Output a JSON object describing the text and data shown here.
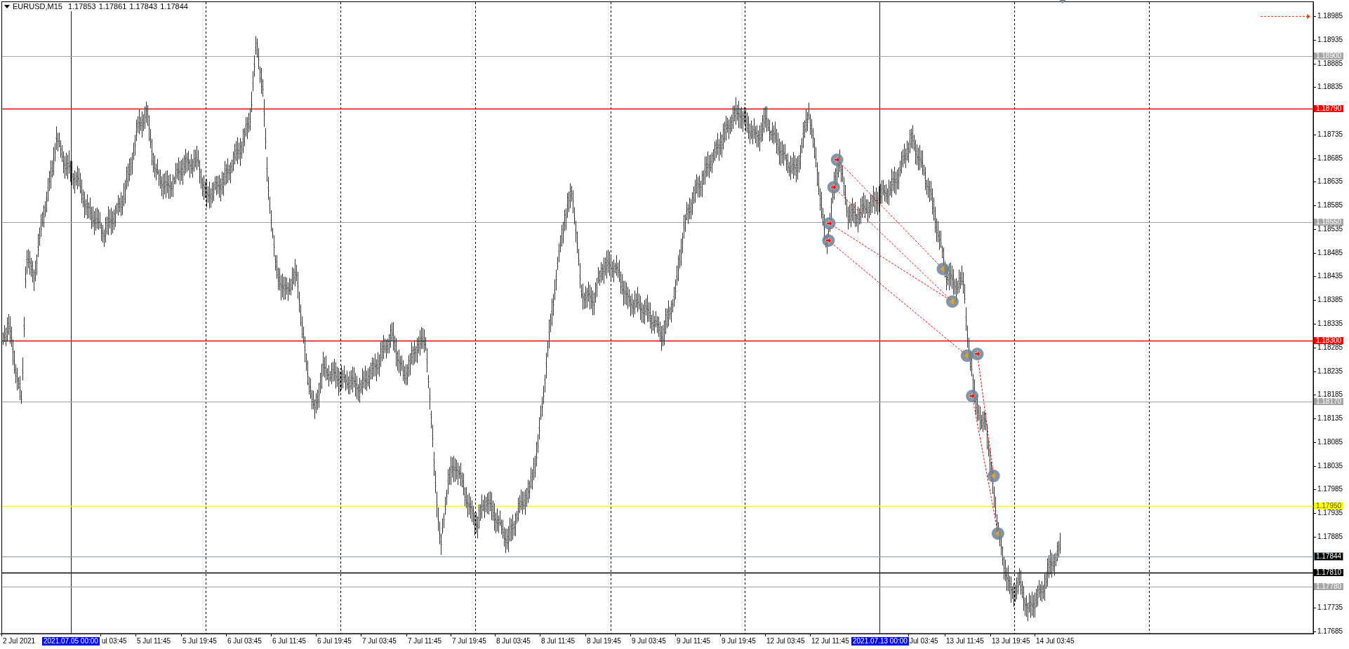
{
  "symbol_info": {
    "symbol": "EURUSD,M15",
    "ohlc": [
      "1.17853",
      "1.17861",
      "1.17843",
      "1.17844"
    ]
  },
  "price_axis": {
    "ticks": [
      "1.18985",
      "1.18935",
      "1.18885",
      "1.18835",
      "1.18735",
      "1.18685",
      "1.18635",
      "1.18585",
      "1.18535",
      "1.18485",
      "1.18435",
      "1.18385",
      "1.18335",
      "1.18285",
      "1.18235",
      "1.18185",
      "1.18135",
      "1.18085",
      "1.18035",
      "1.17985",
      "1.17935",
      "1.17885",
      "1.17735",
      "1.17685"
    ]
  },
  "price_levels": [
    {
      "price": "1.18900",
      "kind": "level",
      "color": "#a6a6a6"
    },
    {
      "price": "1.18790",
      "kind": "level",
      "color": "#ff0000"
    },
    {
      "price": "1.18550",
      "kind": "level",
      "color": "#a6a6a6"
    },
    {
      "price": "1.18300",
      "kind": "level",
      "color": "#ff0000"
    },
    {
      "price": "1.18170",
      "kind": "level",
      "color": "#a6a6a6"
    },
    {
      "price": "1.17950",
      "kind": "level",
      "color": "#ffff00"
    },
    {
      "price": "1.17844",
      "kind": "bid",
      "color": "#8c9aa8"
    },
    {
      "price": "1.17810",
      "kind": "level",
      "color": "#000000"
    },
    {
      "price": "1.17780",
      "kind": "level",
      "color": "#a6a6a6"
    }
  ],
  "time_axis": {
    "labels": [
      {
        "text": "2 Jul 2021",
        "kind": "date"
      },
      {
        "text": "2021.07.05 00:00",
        "kind": "marker"
      },
      {
        "text": "ul 03:45",
        "kind": "date"
      },
      {
        "text": "5 Jul 11:45",
        "kind": "date"
      },
      {
        "text": "5 Jul 19:45",
        "kind": "date"
      },
      {
        "text": "6 Jul 03:45",
        "kind": "date"
      },
      {
        "text": "6 Jul 11:45",
        "kind": "date"
      },
      {
        "text": "6 Jul 19:45",
        "kind": "date"
      },
      {
        "text": "7 Jul 03:45",
        "kind": "date"
      },
      {
        "text": "7 Jul 11:45",
        "kind": "date"
      },
      {
        "text": "7 Jul 19:45",
        "kind": "date"
      },
      {
        "text": "8 Jul 03:45",
        "kind": "date"
      },
      {
        "text": "8 Jul 11:45",
        "kind": "date"
      },
      {
        "text": "8 Jul 19:45",
        "kind": "date"
      },
      {
        "text": "9 Jul 03:45",
        "kind": "date"
      },
      {
        "text": "9 Jul 11:45",
        "kind": "date"
      },
      {
        "text": "9 Jul 19:45",
        "kind": "date"
      },
      {
        "text": "12 Jul 03:45",
        "kind": "date"
      },
      {
        "text": "12 Jul 11:45",
        "kind": "date"
      },
      {
        "text": "2021.07.13 00:00",
        "kind": "marker"
      },
      {
        "text": "Jul 03:45",
        "kind": "date"
      },
      {
        "text": "13 Jul 11:45",
        "kind": "date"
      },
      {
        "text": "13 Jul 19:45",
        "kind": "date"
      },
      {
        "text": "14 Jul 03:45",
        "kind": "date"
      }
    ]
  }
}
